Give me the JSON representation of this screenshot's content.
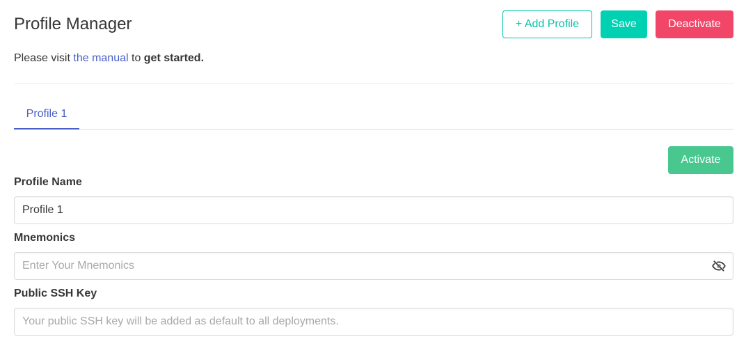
{
  "header": {
    "title": "Profile Manager",
    "add_profile_label": "+ Add Profile",
    "save_label": "Save",
    "deactivate_label": "Deactivate"
  },
  "intro": {
    "prefix": "Please visit ",
    "link_text": "the manual",
    "middle": " to ",
    "bold_text": "get started."
  },
  "tabs": [
    {
      "label": "Profile 1",
      "active": true
    }
  ],
  "activate_label": "Activate",
  "form": {
    "profile_name": {
      "label": "Profile Name",
      "value": "Profile 1"
    },
    "mnemonics": {
      "label": "Mnemonics",
      "placeholder": "Enter Your Mnemonics",
      "value": "",
      "toggle_icon": "eye-slash-icon"
    },
    "ssh_key": {
      "label": "Public SSH Key",
      "placeholder": "Your public SSH key will be added as default to all deployments.",
      "value": ""
    }
  },
  "colors": {
    "primary": "#00d1b2",
    "danger": "#f14668",
    "success": "#48c78e",
    "link": "#485fc7"
  }
}
